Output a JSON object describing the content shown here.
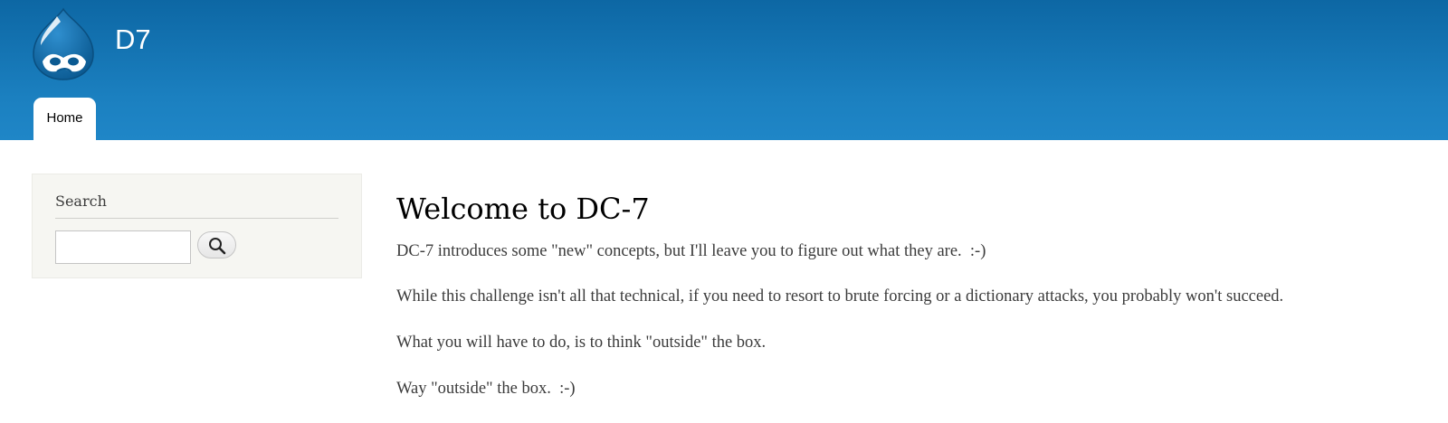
{
  "site": {
    "name": "D7"
  },
  "nav": {
    "tabs": [
      {
        "label": "Home",
        "active": true
      }
    ]
  },
  "sidebar": {
    "search": {
      "title": "Search",
      "input_value": "",
      "button_icon": "search-icon"
    }
  },
  "main": {
    "title": "Welcome to DC-7",
    "paragraphs": [
      "DC-7 introduces some \"new\" concepts, but I'll leave you to figure out what they are.  :-)",
      "While this challenge isn't all that technical, if you need to resort to brute forcing or a dictionary attacks, you probably won't succeed.",
      "What you will have to do, is to think \"outside\" the box.",
      "Way \"outside\" the box.  :-)"
    ]
  },
  "colors": {
    "header_top": "#0d67a4",
    "header_bottom": "#1f86c7",
    "sidebar_bg": "#f6f6f2",
    "body_text": "#3b3b3b"
  }
}
